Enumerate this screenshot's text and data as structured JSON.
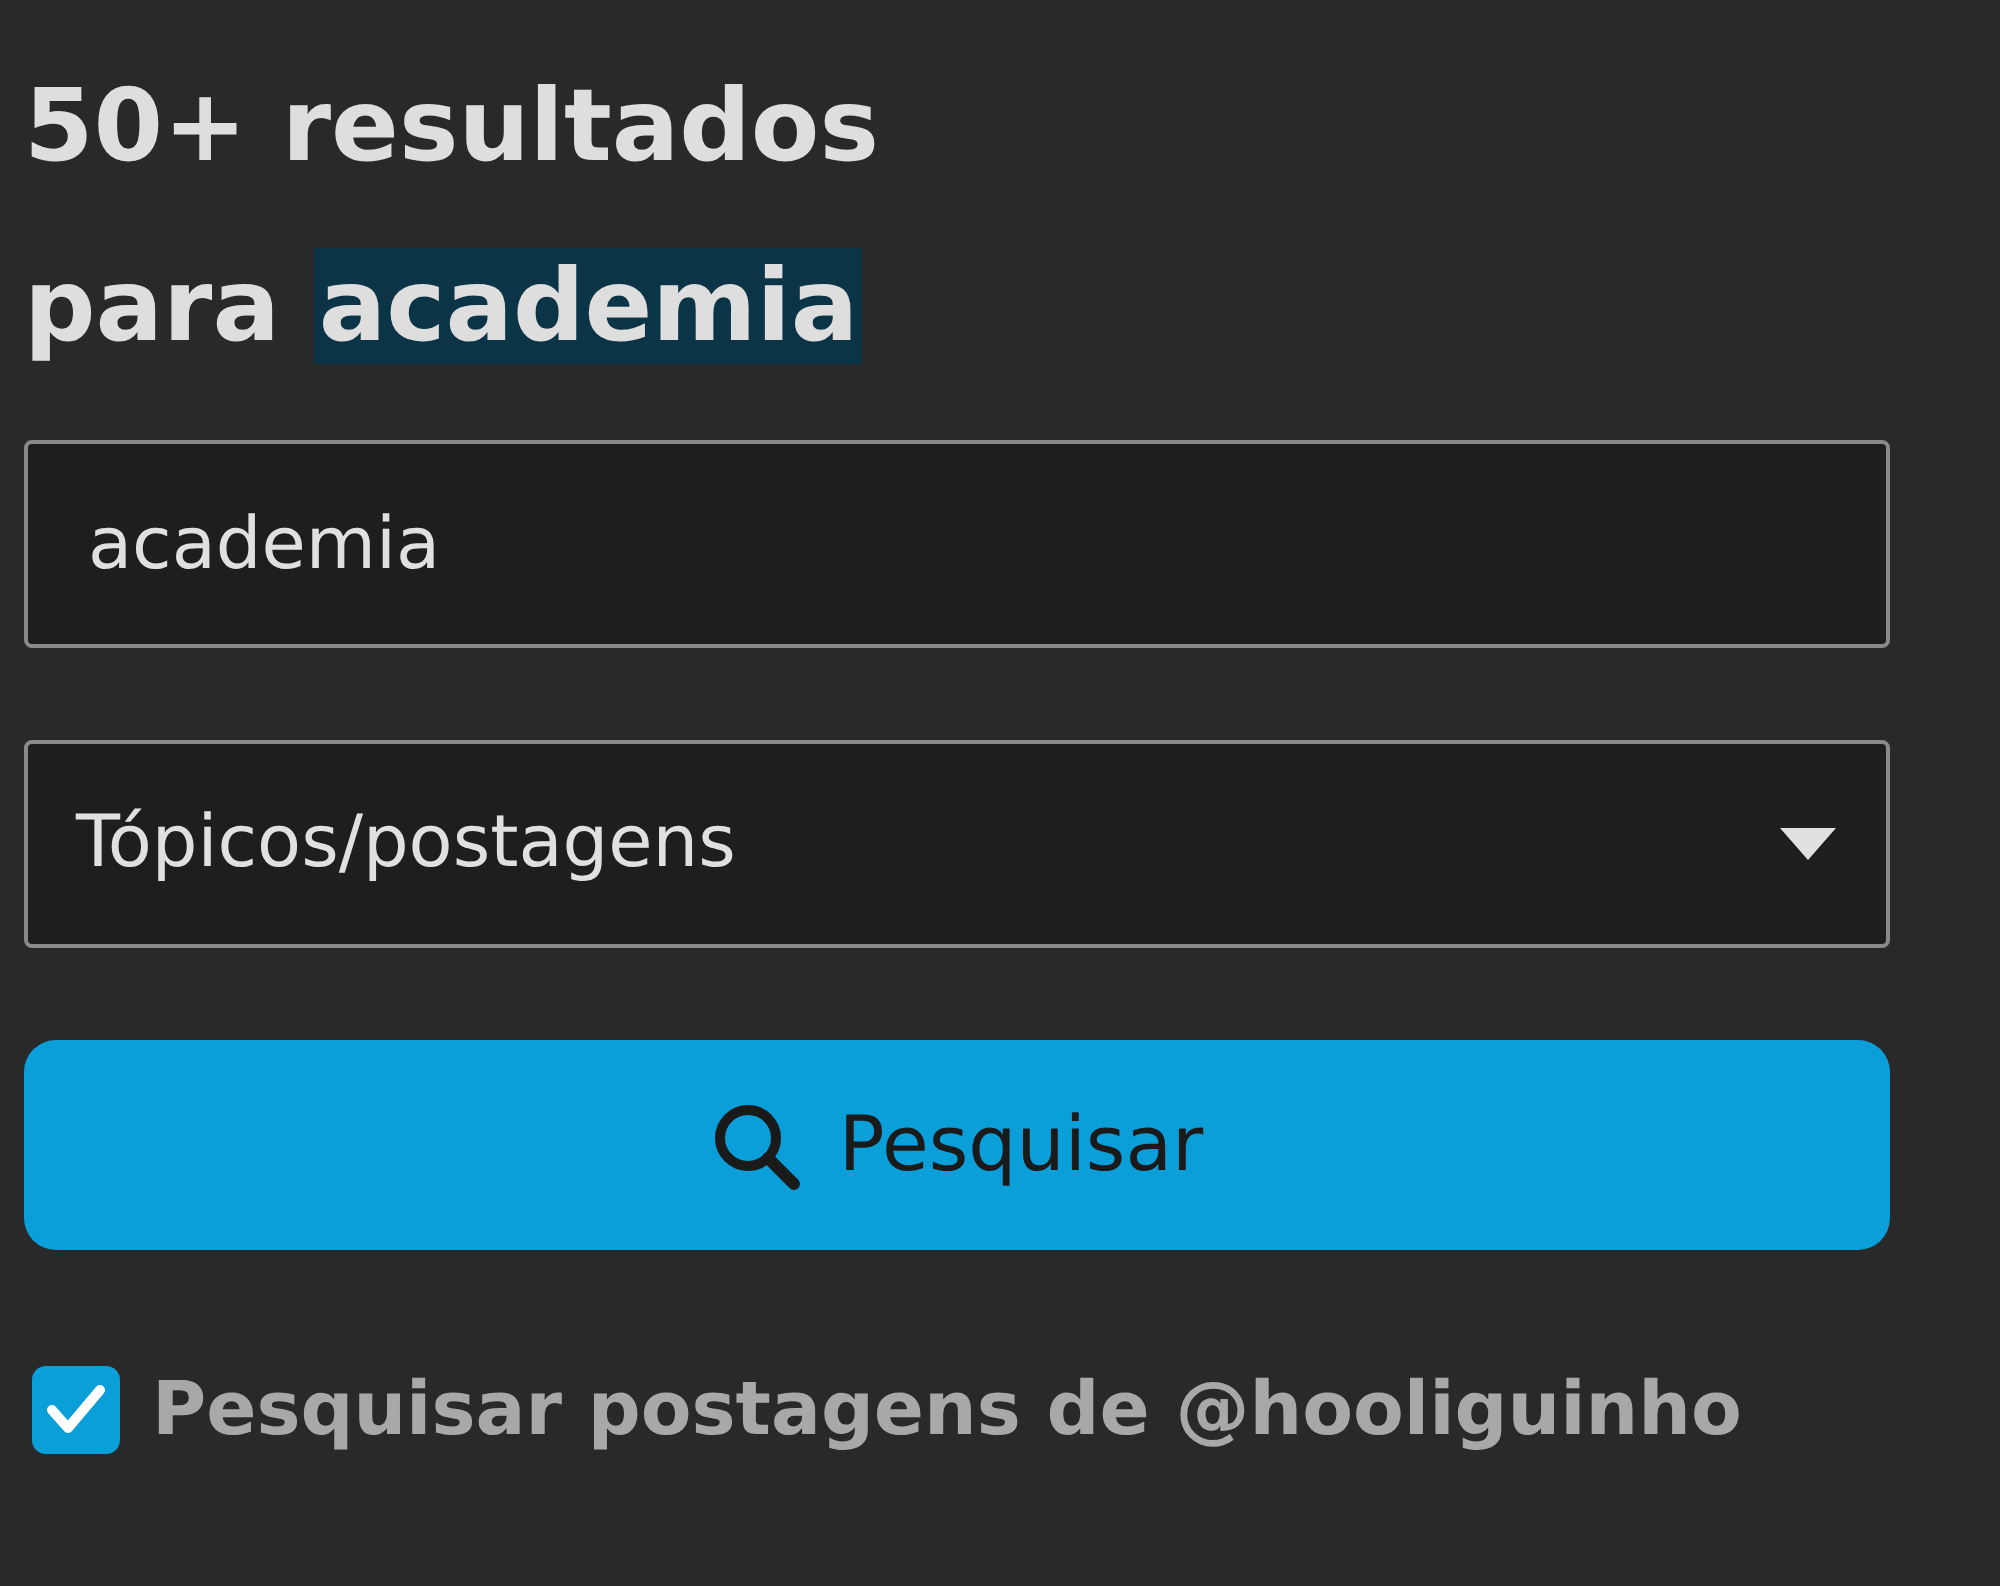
{
  "heading": {
    "text": "50+ resultados para",
    "query": "academia"
  },
  "search_field": {
    "value": "academia"
  },
  "type_select": {
    "value": "Tópicos/postagens"
  },
  "search_button": {
    "label": "Pesquisar"
  },
  "user_filter": {
    "label": "Pesquisar postagens de @hooliguinho",
    "checked": true
  }
}
